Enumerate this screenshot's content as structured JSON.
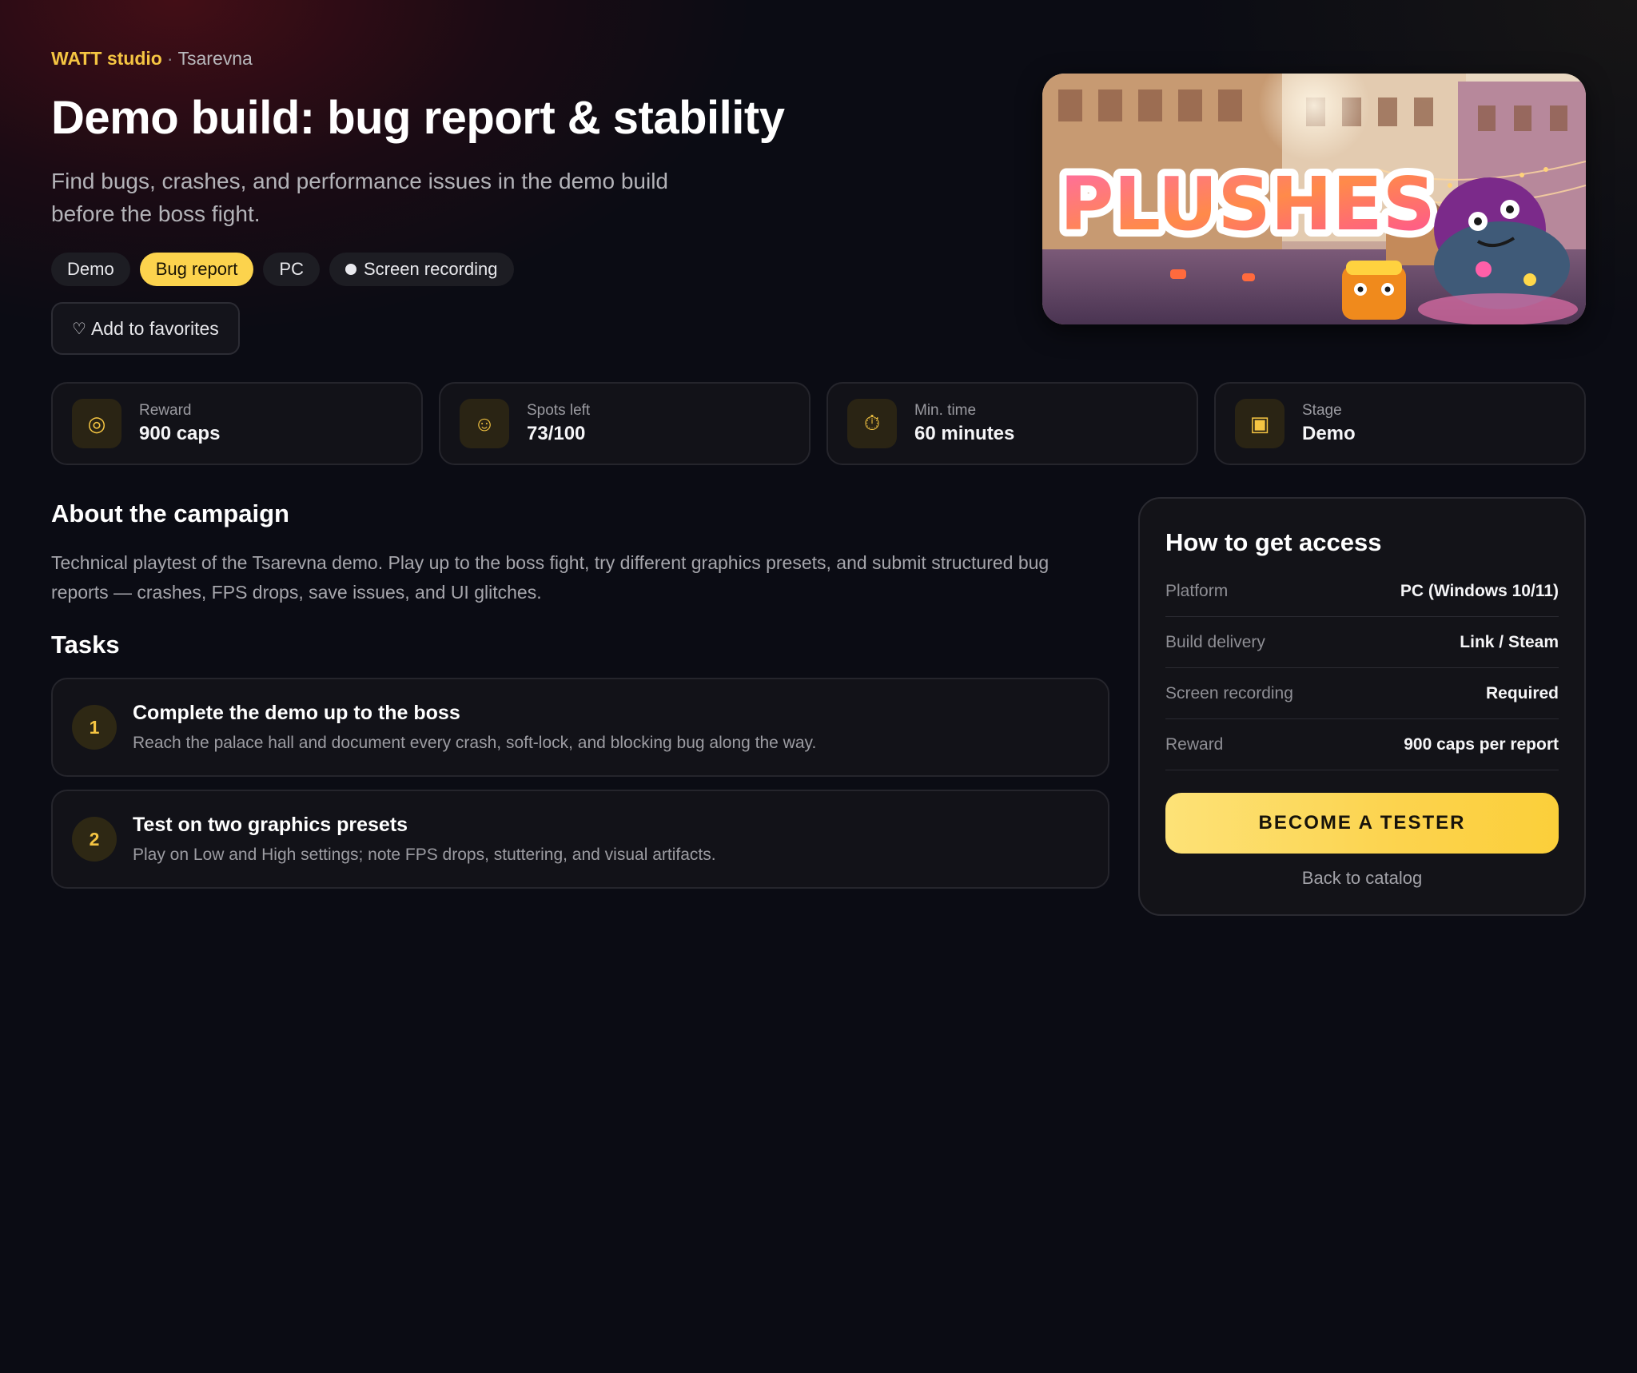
{
  "header": {
    "studio": "WATT studio",
    "separator": "·",
    "game": "Tsarevna",
    "title": "Demo build: bug report & stability",
    "subtitle": "Find bugs, crashes, and performance issues in the demo build before the boss fight."
  },
  "tags": [
    {
      "label": "Demo",
      "active": false
    },
    {
      "label": "Bug report",
      "active": true
    },
    {
      "label": "PC",
      "active": false
    },
    {
      "label": "Screen recording",
      "active": false,
      "icon": "dot-icon"
    }
  ],
  "favorites_button": {
    "icon": "heart-icon",
    "label": "Add to favorites"
  },
  "cover": {
    "logo_text": "PLUSHES"
  },
  "stats": [
    {
      "icon": "target-icon",
      "label": "Reward",
      "value": "900 caps"
    },
    {
      "icon": "smiley-icon",
      "label": "Spots left",
      "value": "73/100"
    },
    {
      "icon": "stopwatch-icon",
      "label": "Min. time",
      "value": "60 minutes"
    },
    {
      "icon": "square-icon",
      "label": "Stage",
      "value": "Demo"
    }
  ],
  "about": {
    "title": "About the campaign",
    "text": "Technical playtest of the Tsarevna demo. Play up to the boss fight, try different graphics presets, and submit structured bug reports — crashes, FPS drops, save issues, and UI glitches."
  },
  "tasks": {
    "title": "Tasks",
    "items": [
      {
        "number": "1",
        "title": "Complete the demo up to the boss",
        "description": "Reach the palace hall and document every crash, soft-lock, and blocking bug along the way."
      },
      {
        "number": "2",
        "title": "Test on two graphics presets",
        "description": "Play on Low and High settings; note FPS drops, stuttering, and visual artifacts."
      }
    ]
  },
  "access": {
    "title": "How to get access",
    "rows": [
      {
        "key": "Platform",
        "value": "PC (Windows 10/11)"
      },
      {
        "key": "Build delivery",
        "value": "Link / Steam"
      },
      {
        "key": "Screen recording",
        "value": "Required"
      },
      {
        "key": "Reward",
        "value": "900 caps per report"
      }
    ],
    "cta_label": "BECOME A TESTER",
    "back_label": "Back to catalog"
  },
  "colors": {
    "accent": "#fcd34d",
    "background": "#0b0c14",
    "card": "#121218"
  }
}
